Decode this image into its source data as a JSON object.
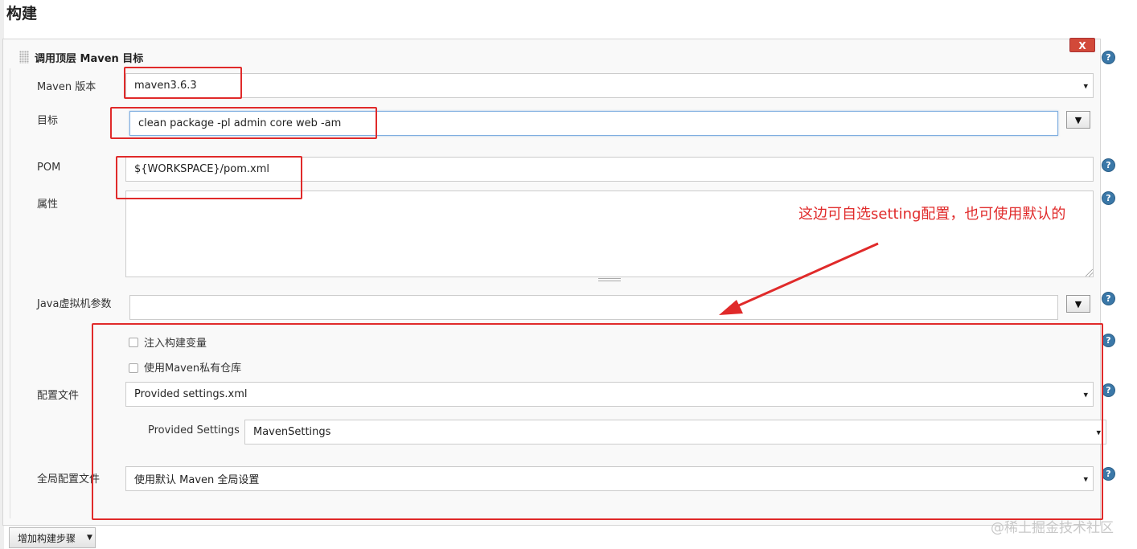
{
  "section_title": "构建",
  "step": {
    "title": "调用顶层 Maven 目标",
    "close_label": "X"
  },
  "fields": {
    "maven_version_label": "Maven 版本",
    "maven_version_value": "maven3.6.3",
    "goals_label": "目标",
    "goals_value": "clean package -pl admin core web -am",
    "pom_label": "POM",
    "pom_value": "${WORKSPACE}/pom.xml",
    "properties_label": "属性",
    "properties_value": "",
    "jvm_label": "Java虚拟机参数",
    "jvm_value": "",
    "inject_vars_label": "注入构建变量",
    "private_repo_label": "使用Maven私有仓库",
    "settings_label": "配置文件",
    "settings_value": "Provided settings.xml",
    "provided_settings_label": "Provided Settings",
    "provided_settings_value": "MavenSettings",
    "global_settings_label": "全局配置文件",
    "global_settings_value": "使用默认 Maven 全局设置"
  },
  "help_glyph": "?",
  "dropdown_glyph": "▼",
  "annotation": "这边可自选setting配置，也可使用默认的",
  "add_step_label": "增加构建步骤",
  "add_step_caret": "▼",
  "watermark": "@稀土掘金技术社区",
  "colors": {
    "annotation_red": "#e02a2a",
    "help_blue": "#3b78a8",
    "close_red": "#d24939"
  }
}
